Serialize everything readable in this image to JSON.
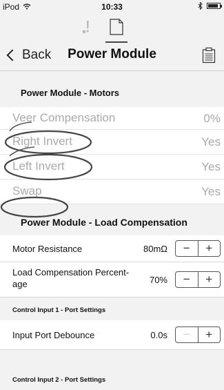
{
  "status_bar": {
    "carrier": "iPod",
    "time": "10:33"
  },
  "nav": {
    "back_label": "Back",
    "title": "Power Module"
  },
  "sections": {
    "motors": {
      "header": "Power Module - Motors",
      "rows": [
        {
          "label": "Veer Compensation",
          "value": "0%"
        },
        {
          "label": "Right Invert",
          "value": "Yes"
        },
        {
          "label": "Left Invert",
          "value": "Yes"
        },
        {
          "label": "Swap",
          "value": "Yes"
        }
      ]
    },
    "load": {
      "header": "Power Module - Load Compensation",
      "motor_resistance": {
        "label": "Motor Resistance",
        "value": "80mΩ"
      },
      "load_percentage": {
        "label_line1": "Load Compensation Percent-",
        "label_line2": "age",
        "value": "70%"
      }
    },
    "control1": {
      "header": "Control Input 1 - Port Settings",
      "debounce": {
        "label": "Input Port Debounce",
        "value": "0.0s"
      }
    },
    "control2": {
      "header": "Control Input 2 - Port Settings"
    }
  },
  "stepper": {
    "minus": "−",
    "plus": "+"
  },
  "tabs": {
    "warning_icon": "warning-icon",
    "document_icon": "document-icon"
  }
}
